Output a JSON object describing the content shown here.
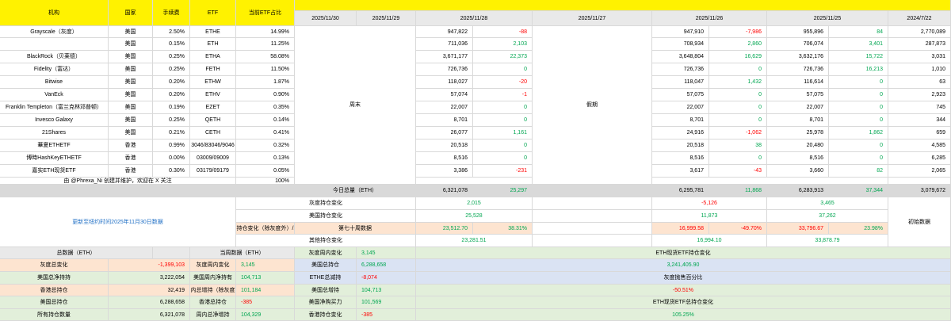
{
  "header": {
    "institution": "机构",
    "country": "国家",
    "fee": "手续费",
    "etf": "ETF",
    "share": "当前ETF占比",
    "dates": [
      "2025/11/30",
      "2025/11/29",
      "2025/11/28",
      "2025/11/27",
      "2025/11/26",
      "2025/11/25",
      "2024/7/22"
    ]
  },
  "rows": [
    {
      "inst": "Grayscale（灰度）",
      "country": "美国",
      "fee": "2.50%",
      "etf": "ETHE",
      "share": "14.99%",
      "v28": "947,822",
      "d28": "-88",
      "v26": "947,910",
      "d26": "-7,986",
      "v25": "955,896",
      "d25": "84",
      "v22": "2,770,089"
    },
    {
      "inst": "",
      "country": "美国",
      "fee": "0.15%",
      "etf": "ETH",
      "share": "11.25%",
      "v28": "711,036",
      "d28": "2,103",
      "v26": "708,934",
      "d26": "2,860",
      "v25": "706,074",
      "d25": "3,401",
      "v22": "287,873"
    },
    {
      "inst": "BlackRock（贝莱德）",
      "country": "美国",
      "fee": "0.25%",
      "etf": "ETHA",
      "share": "58.08%",
      "v28": "3,671,177",
      "d28": "22,373",
      "v26": "3,648,804",
      "d26": "16,629",
      "v25": "3,632,176",
      "d25": "15,722",
      "v22": "3,031"
    },
    {
      "inst": "Fidelity（富达）",
      "country": "美国",
      "fee": "0.25%",
      "etf": "FETH",
      "share": "11.50%",
      "v28": "726,736",
      "d28": "0",
      "v26": "726,736",
      "d26": "0",
      "v25": "726,736",
      "d25": "16,213",
      "v22": "1,010"
    },
    {
      "inst": "Bitwise",
      "country": "美国",
      "fee": "0.20%",
      "etf": "ETHW",
      "share": "1.87%",
      "v28": "118,027",
      "d28": "-20",
      "v26": "118,047",
      "d26": "1,432",
      "v25": "116,614",
      "d25": "0",
      "v22": "63"
    },
    {
      "inst": "VanEck",
      "country": "美国",
      "fee": "0.20%",
      "etf": "ETHV",
      "share": "0.90%",
      "v28": "57,074",
      "d28": "-1",
      "v26": "57,075",
      "d26": "0",
      "v25": "57,075",
      "d25": "0",
      "v22": "2,923"
    },
    {
      "inst": "Franklin Templeton（富兰克林邓普顿）",
      "country": "美国",
      "fee": "0.19%",
      "etf": "EZET",
      "share": "0.35%",
      "v28": "22,007",
      "d28": "0",
      "v26": "22,007",
      "d26": "0",
      "v25": "22,007",
      "d25": "0",
      "v22": "745"
    },
    {
      "inst": "Invesco Galaxy",
      "country": "美国",
      "fee": "0.25%",
      "etf": "QETH",
      "share": "0.14%",
      "v28": "8,701",
      "d28": "0",
      "v26": "8,701",
      "d26": "0",
      "v25": "8,701",
      "d25": "0",
      "v22": "344"
    },
    {
      "inst": "21Shares",
      "country": "美国",
      "fee": "0.21%",
      "etf": "CETH",
      "share": "0.41%",
      "v28": "26,077",
      "d28": "1,161",
      "v26": "24,916",
      "d26": "-1,062",
      "v25": "25,978",
      "d25": "1,862",
      "v22": "659"
    },
    {
      "inst": "華夏ETHETF",
      "country": "香港",
      "fee": "0.99%",
      "etf": "3046/83046/9046",
      "share": "0.32%",
      "v28": "20,518",
      "d28": "0",
      "v26": "20,518",
      "d26": "38",
      "v25": "20,480",
      "d25": "0",
      "v22": "4,585"
    },
    {
      "inst": "博時HashKeyETHETF",
      "country": "香港",
      "fee": "0.00%",
      "etf": "03009/09009",
      "share": "0.13%",
      "v28": "8,516",
      "d28": "0",
      "v26": "8,516",
      "d26": "0",
      "v25": "8,516",
      "d25": "0",
      "v22": "6,285"
    },
    {
      "inst": "嘉实ETH现货ETF",
      "country": "香港",
      "fee": "0.30%",
      "etf": "03179/09179",
      "share": "0.05%",
      "v28": "3,386",
      "d28": "-231",
      "v26": "3,617",
      "d26": "-43",
      "v25": "3,660",
      "d25": "82",
      "v22": "2,065"
    }
  ],
  "credit": {
    "text": "由 @Phrexa_Ni 创建并维护，欢迎在 X 关注",
    "share": "100%"
  },
  "weekend_label": "周末",
  "holiday_label": "假期",
  "totals": {
    "label": "今日总量（ETH）",
    "v28": "6,321,078",
    "d28": "25,297",
    "v26": "6,295,781",
    "d26": "11,868",
    "v25": "6,283,913",
    "d25": "37,344",
    "v22": "3,079,672"
  },
  "updated_note": "更新至纽约时间2025年11月30日数据",
  "changes": {
    "grayscale_label": "灰度持仓变化",
    "grayscale_28": "2,015",
    "grayscale_26": "-5,126",
    "grayscale_25": "3,465",
    "us_label": "美国持仓变化",
    "us_28": "25,528",
    "us_26": "11,873",
    "us_25": "37,262",
    "exgray_label": "美国持仓变化（除灰度外）/增比",
    "week_label": "第七十周数据",
    "exgray_28": "23,512.70",
    "exgray_28_pct": "38.31%",
    "exgray_26": "16,999.58",
    "exgray_26_pct": "-49.70%",
    "exgray_25": "33,796.67",
    "exgray_25_pct": "23.98%",
    "other_label": "其他持仓变化",
    "other_28": "23,281.51",
    "other_26": "16,994.10",
    "other_25": "33,878.79",
    "initial_label": "初始数据"
  },
  "summary": {
    "total_header": "总数据（ETH）",
    "week_header": "当周数据（ETH）",
    "rows_left": [
      {
        "label": "灰度总变化",
        "value": "-1,399,103"
      },
      {
        "label": "美国总净持持",
        "value": "3,222,054"
      },
      {
        "label": "香港总持仓",
        "value": "32,419"
      },
      {
        "label": "美国总持仓",
        "value": "6,288,658"
      },
      {
        "label": "所有持仓数量",
        "value": "6,321,078"
      }
    ],
    "rows_mid": [
      {
        "label": "灰度周内变化",
        "value": "3,145"
      },
      {
        "label": "美国周内净持有",
        "value": "104,713"
      },
      {
        "label": "周内总增持（除灰度）",
        "value": "101,184"
      },
      {
        "label": "香港总持仓",
        "value": "-385"
      },
      {
        "label": "周内总净增持",
        "value": "104,329"
      }
    ],
    "rows_right": [
      {
        "label": "灰度周内变化",
        "value": "3,145"
      },
      {
        "label": "美国总持仓",
        "value": "6,288,658"
      },
      {
        "label": "ETHE总减持",
        "value": "-8,074"
      },
      {
        "label": "美国总增持",
        "value": "104,713"
      },
      {
        "label": "美国净购买力",
        "value": "101,569"
      },
      {
        "label": "香港持仓变化",
        "value": "-385"
      }
    ],
    "far": [
      {
        "text": "ETH现货ETF持仓变化"
      },
      {
        "text": "3,241,405.90"
      },
      {
        "text": "灰度抛售百分比"
      },
      {
        "text": "-50.51%"
      },
      {
        "text": "ETH现货ETF总持仓变化"
      },
      {
        "text": "105.25%"
      }
    ]
  }
}
